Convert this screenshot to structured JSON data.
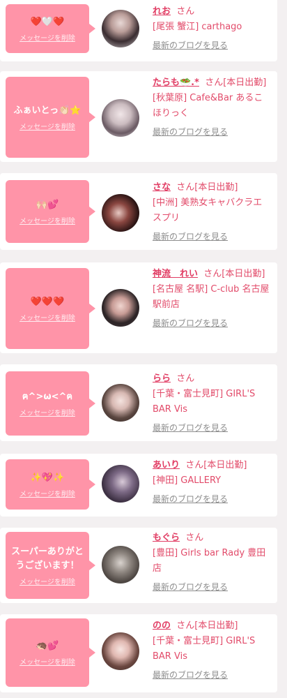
{
  "delete_label": "メッセージを削除",
  "blog_label": "最新のブログを見る",
  "san": "さん",
  "accent": "#ff94a8",
  "entries": [
    {
      "message": "❤️🤍❤️",
      "name": "れお",
      "status": "",
      "shop": "[尾張 蟹江] carthago"
    },
    {
      "message": "ふぁいとっ👏🏻⭐",
      "name": "たらも🥗.*",
      "status": "[本日出勤]",
      "shop": "[秋葉原] Cafe&Bar あるこほりっく"
    },
    {
      "message": "🙌🏻💕",
      "name": "さな",
      "status": "[本日出勤]",
      "shop": "[中洲] 美熟女キャバクラエスプリ"
    },
    {
      "message": "❤️❤️❤️",
      "name": "神流　れい",
      "status": "[本日出勤]",
      "shop": "[名古屋 名駅] C-club 名古屋駅前店"
    },
    {
      "message": "ฅ^>ω<^ฅ",
      "name": "らら",
      "status": "",
      "shop": "[千葉・富士見町] GIRL'S BAR Vis"
    },
    {
      "message": "✨💖✨",
      "name": "あいり",
      "status": "[本日出勤]",
      "shop": "[神田] GALLERY"
    },
    {
      "message": "スーパーありがとうございます！",
      "name": "もぐら",
      "status": "",
      "shop": "[豊田] Girls bar Rady 豊田店"
    },
    {
      "message": "🦔💕",
      "name": "のの",
      "status": "[本日出勤]",
      "shop": "[千葉・富士見町] GIRL'S BAR Vis"
    }
  ]
}
